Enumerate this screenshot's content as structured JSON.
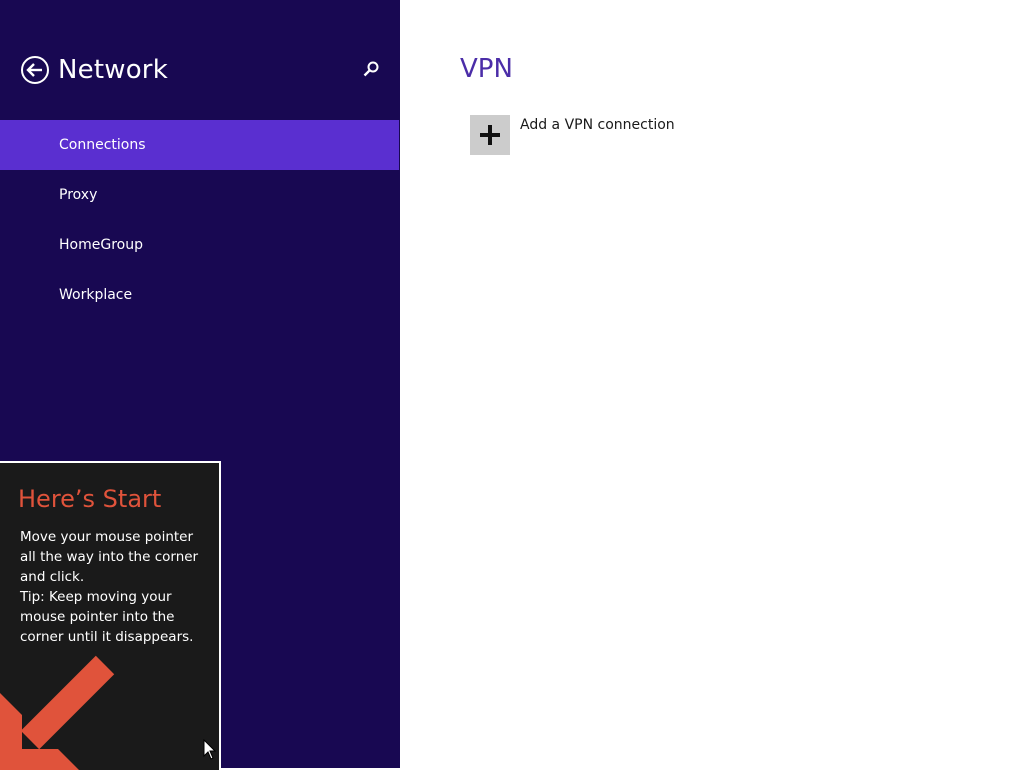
{
  "sidebar": {
    "title": "Network",
    "back_icon": "back-arrow-icon",
    "search_icon": "search-icon",
    "items": [
      {
        "label": "Connections",
        "selected": true
      },
      {
        "label": "Proxy",
        "selected": false
      },
      {
        "label": "HomeGroup",
        "selected": false
      },
      {
        "label": "Workplace",
        "selected": false
      }
    ]
  },
  "tip": {
    "title": "Here’s Start",
    "lines": [
      "Move your mouse pointer",
      "all the way into the corner",
      "and click.",
      "Tip: Keep moving your",
      "mouse pointer into the",
      "corner until it disappears."
    ],
    "arrow_icon": "corner-arrow-icon"
  },
  "main": {
    "section_title": "VPN",
    "add_vpn_label": "Add a VPN connection",
    "add_icon": "plus-icon"
  },
  "colors": {
    "sidebar_bg": "#180852",
    "selected_bg": "#5a2fd0",
    "accent": "#4b2da8",
    "tip_title": "#e0533b",
    "tip_bg": "#1a1a1a"
  }
}
